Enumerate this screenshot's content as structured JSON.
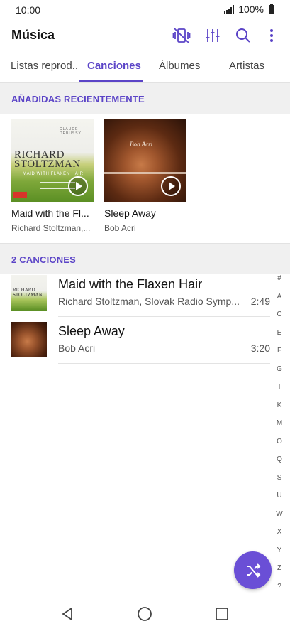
{
  "status_bar": {
    "time": "10:00",
    "battery": "100%"
  },
  "app_bar": {
    "title": "Música"
  },
  "tabs": [
    {
      "label": "Listas reprod.."
    },
    {
      "label": "Canciones"
    },
    {
      "label": "Álbumes"
    },
    {
      "label": "Artistas"
    }
  ],
  "recent": {
    "header": "AÑADIDAS RECIENTEMENTE",
    "albums": [
      {
        "title": "Maid with the Fl...",
        "artist": "Richard Stoltzman,...",
        "cover_text_1": "RICHARD",
        "cover_text_2": "STOLTZMAN",
        "cover_sub": "MAID WITH FLAXEN HAIR",
        "cover_top": "CLAUDE DEBUSSY"
      },
      {
        "title": "Sleep Away",
        "artist": "Bob Acri",
        "cover_text_1": "Bob Acri"
      }
    ]
  },
  "songs": {
    "header": "2 CANCIONES",
    "items": [
      {
        "title": "Maid with the Flaxen Hair",
        "artist": "Richard Stoltzman, Slovak Radio Symp...",
        "duration": "2:49"
      },
      {
        "title": "Sleep Away",
        "artist": "Bob Acri",
        "duration": "3:20"
      }
    ]
  },
  "index_letters": [
    "#",
    "A",
    "C",
    "E",
    "F",
    "G",
    "I",
    "K",
    "M",
    "O",
    "Q",
    "S",
    "U",
    "W",
    "X",
    "Y",
    "Z",
    "?"
  ],
  "colors": {
    "accent": "#5b44c7",
    "fab": "#6a4fd6"
  }
}
